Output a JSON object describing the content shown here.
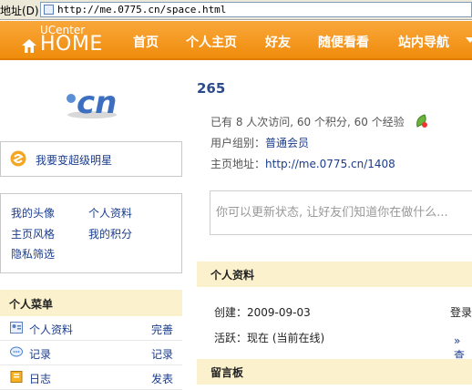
{
  "browser": {
    "address_label": "地址(D)",
    "url": "http://me.0775.cn/space.html"
  },
  "header": {
    "brand_small": "UCenter",
    "brand_big": "HOME",
    "nav": [
      "首页",
      "个人主页",
      "好友",
      "随便看看",
      "站内导航"
    ]
  },
  "sidebar": {
    "avatar_text": "cn",
    "star_link": "我要变超级明星",
    "quick_links": [
      "我的头像",
      "个人资料",
      "主页风格",
      "我的积分",
      "隐私筛选"
    ],
    "menu_title": "个人菜单",
    "menu_items": [
      {
        "label": "个人资料",
        "action": "完善",
        "icon": "profile-card-icon"
      },
      {
        "label": "记录",
        "action": "记录",
        "icon": "speech-bubble-icon"
      },
      {
        "label": "日志",
        "action": "发表",
        "icon": "journal-icon"
      }
    ]
  },
  "main": {
    "username": "265",
    "stats": "已有 8 人次访问, 60 个积分, 60 个经验",
    "group_label": "用户组别：",
    "group_value": "普通会员",
    "home_label": "主页地址：",
    "home_url": "http://me.0775.cn/1408",
    "status_placeholder": "你可以更新状态, 让好友们知道你在做什么...",
    "profile_title": "个人资料",
    "created_label": "创建：",
    "created_value": "2009-09-03",
    "active_label": "活跃：",
    "active_value": "现在 (当前在线)",
    "login_partial": "登录",
    "more_partial": "» 查",
    "guestbook_title": "留言板"
  },
  "colors": {
    "header_orange": "#f59a1f",
    "link_blue": "#1a3d8f",
    "section_bg": "#fbf1cd"
  }
}
